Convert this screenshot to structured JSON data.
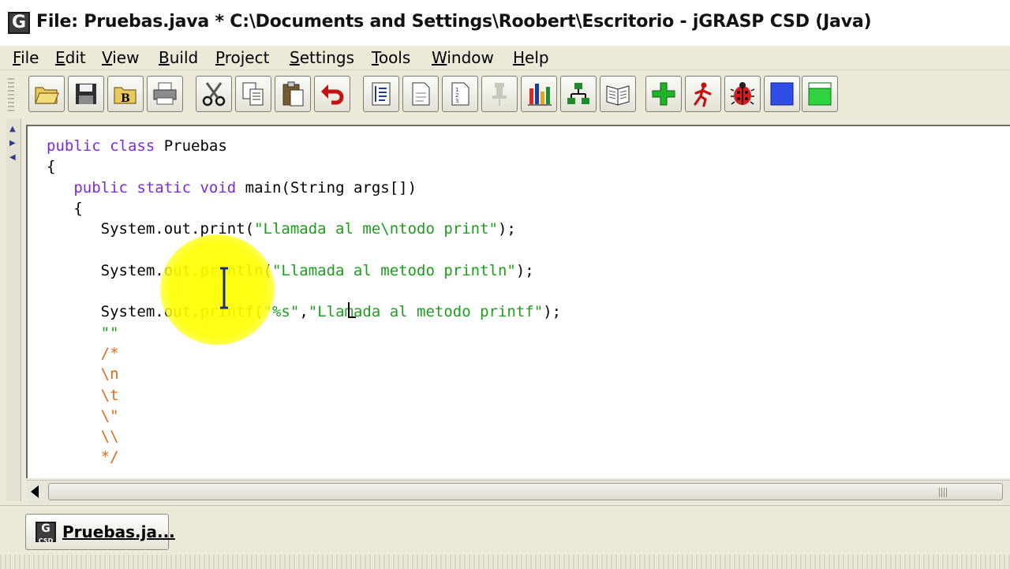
{
  "window": {
    "title": "File: Pruebas.java *  C:\\Documents and Settings\\Roobert\\Escritorio - jGRASP CSD (Java)",
    "app_icon_letter": "G"
  },
  "menu": [
    {
      "label": "File",
      "key": "F",
      "rest": "ile"
    },
    {
      "label": "Edit",
      "key": "E",
      "rest": "dit"
    },
    {
      "label": "View",
      "key": "V",
      "rest": "iew"
    },
    {
      "label": "Build",
      "key": "B",
      "rest": "uild"
    },
    {
      "label": "Project",
      "key": "P",
      "rest": "roject"
    },
    {
      "label": "Settings",
      "key": "S",
      "rest": "ettings"
    },
    {
      "label": "Tools",
      "key": "T",
      "rest": "ools"
    },
    {
      "label": "Window",
      "key": "W",
      "rest": "indow"
    },
    {
      "label": "Help",
      "key": "H",
      "rest": "elp"
    }
  ],
  "toolbar_icons": [
    "open-folder-icon",
    "save-icon",
    "browse-icon",
    "print-icon",
    "cut-icon",
    "copy-icon",
    "paste-icon",
    "undo-icon",
    "generate-csd-icon",
    "remove-csd-icon",
    "line-numbers-icon",
    "pin-icon",
    "chart-icon",
    "uml-icon",
    "book-icon",
    "compile-icon",
    "run-icon",
    "debug-icon",
    "stop-icon",
    "window-icon"
  ],
  "colors": {
    "keyword": "#7b2bd9",
    "string": "#1a9f1a",
    "comment": "#e06a1a",
    "highlight": "#ffff00"
  },
  "code": {
    "l1_kw": "public class",
    "l1_rest": " Pruebas",
    "l2": "{",
    "l3_kw": "public static void",
    "l3_rest": " main(String args[])",
    "l4": "{",
    "l5_pre": "System.out.print(",
    "l5_str": "\"Llamada al me\\ntodo print\"",
    "l5_post": ");",
    "l6_pre": "System.out.println(",
    "l6_str": "\"Llamada al metodo println\"",
    "l6_post": ");",
    "l7_pre": "System.out.printf(",
    "l7_str1": "\"%s\"",
    "l7_mid": ",",
    "l7_str2": "\"Llamada al metodo printf\"",
    "l7_post": ");",
    "l8": "\"\"",
    "l9": "/*",
    "l10": "\\n",
    "l11": "\\t",
    "l12": "\\\"",
    "l13": "\\\\",
    "l14": "*/"
  },
  "tab": {
    "label": "Pruebas.ja...",
    "icon_text": "G\nCSD"
  }
}
